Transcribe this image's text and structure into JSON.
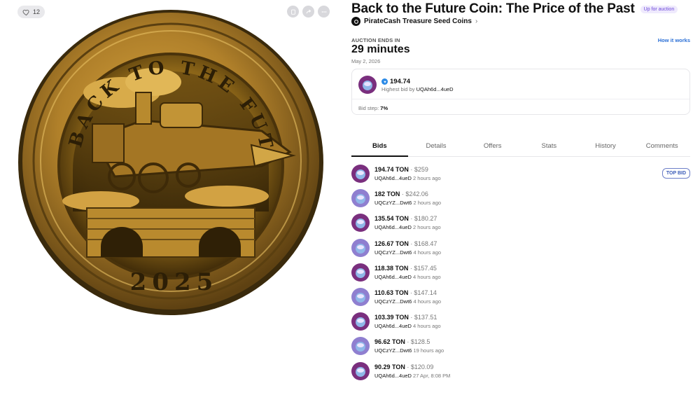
{
  "media": {
    "like_count": "12",
    "coin_text_top": "BACK TO THE FUTURE",
    "coin_year": "2025",
    "actions": [
      "favorite-icon",
      "share-icon",
      "more-icon"
    ]
  },
  "item": {
    "title": "Back to the Future Coin: The Price of the Past",
    "status_badge": "Up for auction",
    "collection": "PirateCash Treasure Seed Coins"
  },
  "auction": {
    "ends_label": "AUCTION ENDS IN",
    "time_left": "29 minutes",
    "end_date": "May 2, 2026",
    "how_it_works": "How it works"
  },
  "highest_bid": {
    "amount": "194.74",
    "by_label": "Highest bid by",
    "bidder": "UQAh6d...4ueD",
    "bid_step_label": "Bid step:",
    "bid_step_value": "7%"
  },
  "tabs": [
    "Bids",
    "Details",
    "Offers",
    "Stats",
    "History",
    "Comments"
  ],
  "active_tab": "Bids",
  "top_bid_label": "TOP BID",
  "bids": [
    {
      "amount": "194.74 TON",
      "usd": "$259",
      "address": "UQAh6d...4ueD",
      "time": "2 hours ago",
      "avatar": "A"
    },
    {
      "amount": "182 TON",
      "usd": "$242.06",
      "address": "UQCzYZ...Dwt6",
      "time": "2 hours ago",
      "avatar": "B"
    },
    {
      "amount": "135.54 TON",
      "usd": "$180.27",
      "address": "UQAh6d...4ueD",
      "time": "2 hours ago",
      "avatar": "A"
    },
    {
      "amount": "126.67 TON",
      "usd": "$168.47",
      "address": "UQCzYZ...Dwt6",
      "time": "4 hours ago",
      "avatar": "B"
    },
    {
      "amount": "118.38 TON",
      "usd": "$157.45",
      "address": "UQAh6d...4ueD",
      "time": "4 hours ago",
      "avatar": "A"
    },
    {
      "amount": "110.63 TON",
      "usd": "$147.14",
      "address": "UQCzYZ...Dwt6",
      "time": "4 hours ago",
      "avatar": "B"
    },
    {
      "amount": "103.39 TON",
      "usd": "$137.51",
      "address": "UQAh6d...4ueD",
      "time": "4 hours ago",
      "avatar": "A"
    },
    {
      "amount": "96.62 TON",
      "usd": "$128.5",
      "address": "UQCzYZ...Dwt6",
      "time": "19 hours ago",
      "avatar": "B"
    },
    {
      "amount": "90.29 TON",
      "usd": "$120.09",
      "address": "UQAh6d...4ueD",
      "time": "27 Apr, 8:08 PM",
      "avatar": "A"
    }
  ],
  "colors": {
    "accent_link": "#2a6fd6",
    "badge_purple": "#6b46d9",
    "avatar_a": "#7a2f7e",
    "avatar_b": "#8f7fd0",
    "ton_blue": "#2b8ae6"
  }
}
